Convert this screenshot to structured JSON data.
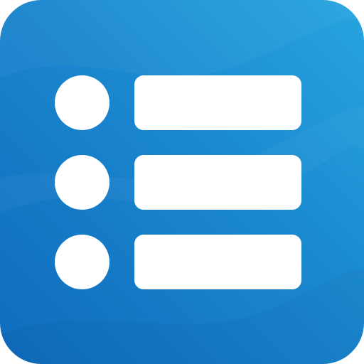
{
  "icon": {
    "name": "list-icon",
    "colors": {
      "background_start": "#26a5de",
      "background_mid": "#1a87cf",
      "background_end": "#0f6bbc",
      "foreground": "#ffffff"
    },
    "items": [
      {
        "bullet": "bullet-icon",
        "bar": "line-bar"
      },
      {
        "bullet": "bullet-icon",
        "bar": "line-bar"
      },
      {
        "bullet": "bullet-icon",
        "bar": "line-bar"
      }
    ]
  }
}
